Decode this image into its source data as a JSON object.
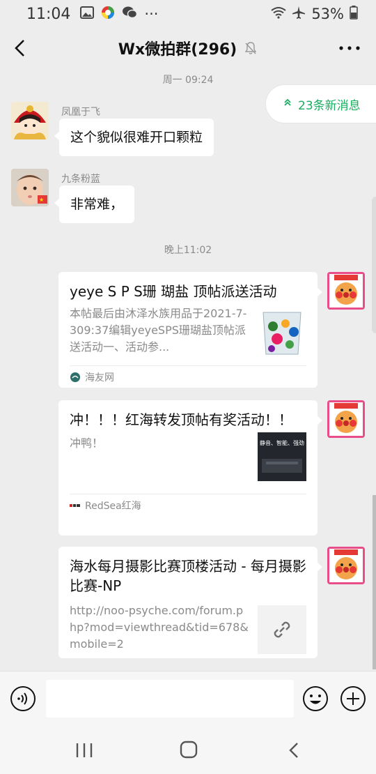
{
  "status_bar": {
    "time": "11:04",
    "more": "···",
    "battery": "53%"
  },
  "header": {
    "title": "Wx微拍群(296)"
  },
  "chat": {
    "new_messages": "23条新消息",
    "timestamp_1": "周一 09:24",
    "timestamp_2": "晚上11:02",
    "messages": [
      {
        "sender": "凤凰于飞",
        "text": "这个貌似很难开口颗粒"
      },
      {
        "sender": "九条粉蓝",
        "text": "非常难，"
      }
    ],
    "cards": [
      {
        "title": "yeye S P S珊 瑚盐 顶帖派送活动",
        "desc": "本帖最后由沐泽水族用品于2021-7-309:37编辑yeyeSPS珊瑚盐顶帖派送活动一、活动参...",
        "source": "海友网"
      },
      {
        "title": "冲！！！红海转发顶帖有奖活动！！",
        "desc": "冲鸭！",
        "thumb_text": "静音、智能、强劲",
        "source": "RedSea红海"
      },
      {
        "title": "海水每月摄影比赛顶楼活动 - 每月摄影比赛-NP",
        "desc": "http://noo-psyche.com/forum.php?mod=viewthread&tid=678&mobile=2"
      }
    ]
  },
  "input": {
    "value": "",
    "placeholder": ""
  },
  "colors": {
    "accent": "#1aad60",
    "background": "#ededed"
  }
}
